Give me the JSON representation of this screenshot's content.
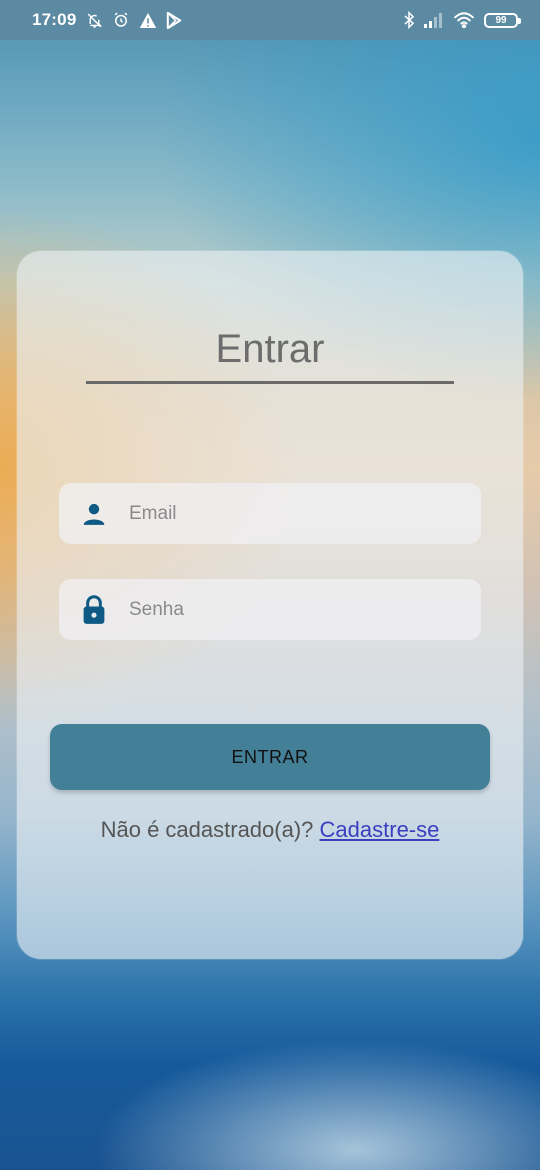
{
  "status_bar": {
    "time": "17:09",
    "left_icons": [
      "notifications-off-icon",
      "alarm-icon",
      "warning-icon",
      "play-store-icon"
    ],
    "right_icons": [
      "bluetooth-icon",
      "signal-icon",
      "wifi-icon",
      "battery-icon"
    ],
    "battery": "99"
  },
  "login": {
    "title": "Entrar",
    "email_placeholder": "Email",
    "password_placeholder": "Senha",
    "submit_label": "ENTRAR",
    "signup_prompt": "Não é cadastrado(a)?",
    "signup_link": "Cadastre-se"
  },
  "colors": {
    "accent": "#437f97",
    "icon": "#0e5a85",
    "link": "#3a3ec0"
  }
}
